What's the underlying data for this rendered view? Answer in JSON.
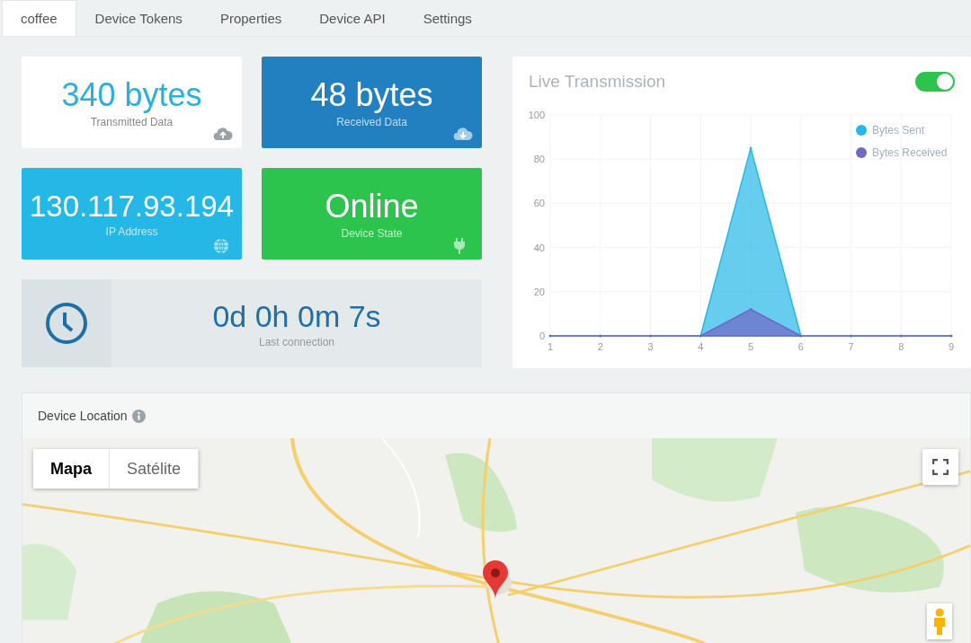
{
  "tabs": [
    {
      "label": "coffee",
      "selected": true
    },
    {
      "label": "Device Tokens",
      "selected": false
    },
    {
      "label": "Properties",
      "selected": false
    },
    {
      "label": "Device API",
      "selected": false
    },
    {
      "label": "Settings",
      "selected": false
    }
  ],
  "stats": [
    {
      "value": "340 bytes",
      "label": "Transmitted Data",
      "kind": "upload",
      "color": "#ffffff"
    },
    {
      "value": "48 bytes",
      "label": "Received Data",
      "kind": "download",
      "color": "#2380c0"
    },
    {
      "value": "130.117.93.194",
      "label": "IP Address",
      "kind": "globe",
      "color": "#25b8e7"
    },
    {
      "value": "Online",
      "label": "Device State",
      "kind": "plug",
      "color": "#2cc44d"
    }
  ],
  "last_connection": {
    "value": "0d 0h 0m 7s",
    "label": "Last connection"
  },
  "live": {
    "title": "Live Transmission",
    "on": true,
    "chart_data": {
      "type": "area",
      "x": [
        1,
        2,
        3,
        4,
        5,
        6,
        7,
        8,
        9
      ],
      "series": [
        {
          "name": "Bytes Sent",
          "color": "#25b8e7",
          "values": [
            0,
            0,
            0,
            0,
            85,
            0,
            0,
            0,
            0
          ]
        },
        {
          "name": "Bytes Received",
          "color": "#6f68c6",
          "values": [
            0,
            0,
            0,
            0,
            12,
            0,
            0,
            0,
            0
          ]
        }
      ],
      "xlim": [
        1,
        9
      ],
      "ylim": [
        0,
        100
      ],
      "grid": true,
      "legend": "top-right",
      "yticks": [
        0,
        20,
        40,
        60,
        80,
        100
      ],
      "xticks": [
        1,
        2,
        3,
        4,
        5,
        6,
        7,
        8,
        9
      ]
    }
  },
  "location": {
    "title": "Device Location",
    "map_types": [
      {
        "label": "Mapa",
        "selected": true
      },
      {
        "label": "Satélite",
        "selected": false
      }
    ]
  }
}
